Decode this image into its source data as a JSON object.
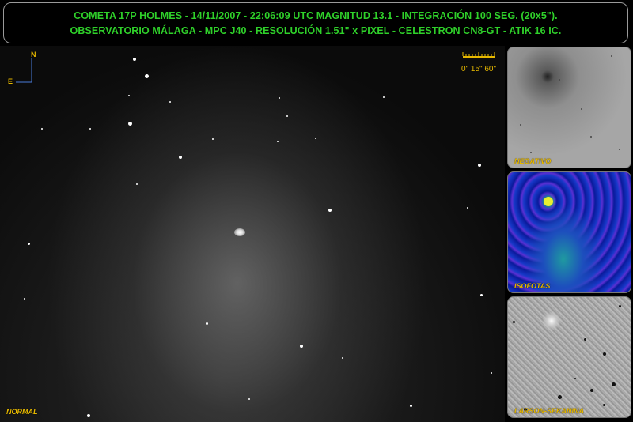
{
  "header": {
    "line1": "COMETA 17P HOLMES - 14/11/2007 - 22:06:09 UTC MAGNITUD 13.1 - INTEGRACIÓN 100 SEG. (20x5\").",
    "line2": "OBSERVATORIO MÁLAGA  - MPC J40 - RESOLUCIÓN 1.51\" x PIXEL - CELESTRON CN8-GT - ATIK 16 IC."
  },
  "main": {
    "label": "NORMAL",
    "compass": {
      "north": "N",
      "east": "E"
    },
    "scale_label": "0\"  15\"  60\""
  },
  "panels": [
    {
      "label": "NEGATIVO"
    },
    {
      "label": "ISOFOTAS"
    },
    {
      "label": "LARSON-SEKANINA"
    }
  ],
  "colors": {
    "header_text": "#2fd12a",
    "label_text": "#e6b800",
    "background": "#000000"
  }
}
